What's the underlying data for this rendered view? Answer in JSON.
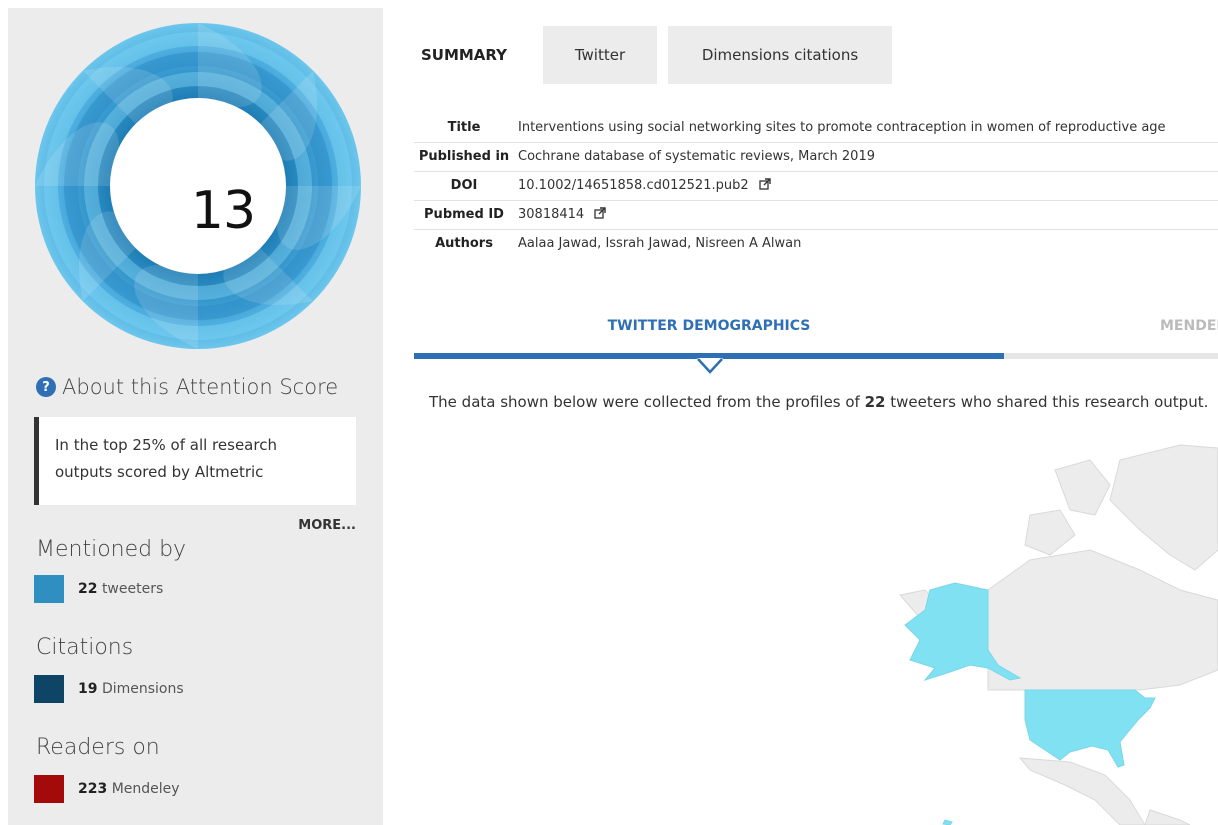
{
  "sidebar": {
    "score": "13",
    "about_title": "About this Attention Score",
    "rank_text": "In the top 25% of all research outputs scored by Altmetric",
    "more_label": "MORE...",
    "mentioned_title": "Mentioned by",
    "tweeters": {
      "count": "22",
      "label": "tweeters",
      "color": "#2f8fc1"
    },
    "citations_title": "Citations",
    "dimensions": {
      "count": "19",
      "label": "Dimensions",
      "color": "#0e4466"
    },
    "readers_title": "Readers on",
    "mendeley": {
      "count": "223",
      "label": "Mendeley",
      "color": "#a50a0a"
    }
  },
  "tabs": {
    "summary": "SUMMARY",
    "twitter": "Twitter",
    "dimensions": "Dimensions citations"
  },
  "details": {
    "title_label": "Title",
    "title_value": "Interventions using social networking sites to promote contraception in women of reproductive age",
    "published_label": "Published in",
    "published_value": "Cochrane database of systematic reviews, March 2019",
    "doi_label": "DOI",
    "doi_value": "10.1002/14651858.cd012521.pub2",
    "pubmed_label": "Pubmed ID",
    "pubmed_value": "30818414",
    "authors_label": "Authors",
    "authors_value": "Aalaa Jawad, Issrah Jawad, Nisreen A Alwan"
  },
  "demographics": {
    "active_tab": "TWITTER DEMOGRAPHICS",
    "next_tab": "MENDELEY READERS",
    "desc_prefix": "The data shown below were collected from the profiles of ",
    "desc_count": "22",
    "desc_suffix": " tweeters who shared this research output."
  },
  "colors": {
    "accent": "#2e6fb5",
    "map_highlight": "#80e1f2",
    "map_base": "#ececec"
  }
}
